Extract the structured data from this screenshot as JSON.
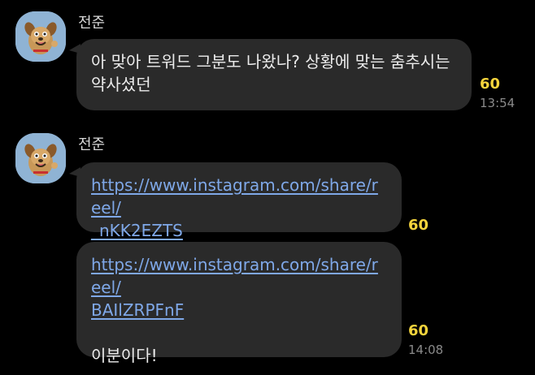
{
  "messages": [
    {
      "sender": "전준",
      "text_line1": "아 맞아 트워드 그분도 나왔나? 상황에 맞는 춤추시는",
      "text_line2": "약사셨던",
      "unread": "60",
      "time": "13:54"
    },
    {
      "sender": "전준",
      "link_line1": "https://www.instagram.com/share/reel/",
      "link_line2": "_nKK2EZTS",
      "unread": "60"
    },
    {
      "link_line1": "https://www.instagram.com/share/reel/",
      "link_line2": "BAIlZRPFnF",
      "text": "이분이다!",
      "unread": "60",
      "time": "14:08"
    }
  ],
  "avatar_icon": "dog-character-icon",
  "colors": {
    "background": "#000000",
    "bubble": "#2a2a2a",
    "link": "#7fa8e8",
    "unread": "#f4d43c",
    "avatar_bg": "#8fb3d4"
  }
}
